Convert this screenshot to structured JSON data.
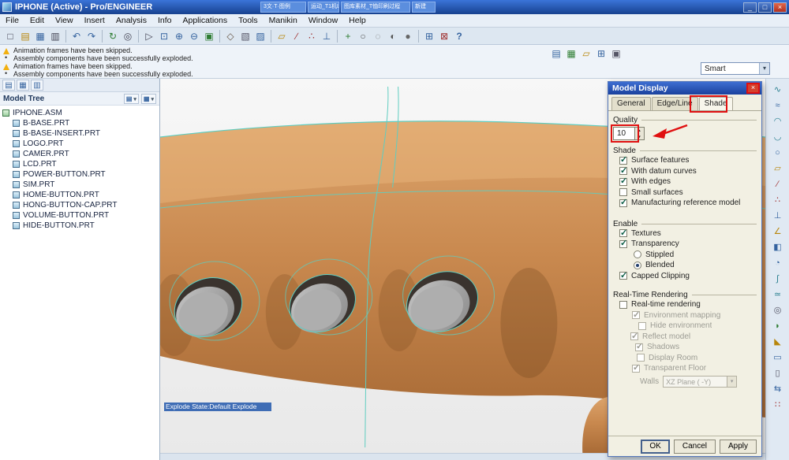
{
  "titlebar": {
    "title": "IPHONE (Active) - Pro/ENGINEER",
    "tabs": [
      "3文·T·图例",
      "运动_T1机L",
      "图库素材_T恤印刷过程",
      "新建"
    ],
    "min": "_",
    "max": "□",
    "close": "×"
  },
  "menu": [
    "File",
    "Edit",
    "View",
    "Insert",
    "Analysis",
    "Info",
    "Applications",
    "Tools",
    "Manikin",
    "Window",
    "Help"
  ],
  "toolbar_icons": [
    {
      "name": "new-file-icon",
      "glyph": "□"
    },
    {
      "name": "open-icon",
      "glyph": "▤"
    },
    {
      "name": "save-icon",
      "glyph": "▦"
    },
    {
      "name": "print-icon",
      "glyph": "▥"
    },
    {
      "name": "undo-icon",
      "glyph": "↶"
    },
    {
      "name": "redo-icon",
      "glyph": "↷"
    },
    {
      "name": "regenerate-icon",
      "glyph": "↻"
    },
    {
      "name": "search-icon",
      "glyph": "◎"
    },
    {
      "name": "select-arrow-icon",
      "glyph": "▷"
    },
    {
      "name": "refit-icon",
      "glyph": "⊡"
    },
    {
      "name": "zoom-in-icon",
      "glyph": "⊕"
    },
    {
      "name": "zoom-out-icon",
      "glyph": "⊖"
    },
    {
      "name": "repaint-icon",
      "glyph": "▣"
    },
    {
      "name": "orientation-icon",
      "glyph": "◇"
    },
    {
      "name": "layers-icon",
      "glyph": "▧"
    },
    {
      "name": "view-manager-icon",
      "glyph": "▨"
    },
    {
      "name": "datum-plane-toggle-icon",
      "glyph": "▱"
    },
    {
      "name": "datum-axis-toggle-icon",
      "glyph": "∕"
    },
    {
      "name": "datum-point-toggle-icon",
      "glyph": "∴"
    },
    {
      "name": "csys-toggle-icon",
      "glyph": "⊥"
    },
    {
      "name": "spin-center-icon",
      "glyph": "+"
    },
    {
      "name": "wireframe-icon",
      "glyph": "○"
    },
    {
      "name": "hidden-line-icon",
      "glyph": "◌"
    },
    {
      "name": "no-hidden-icon",
      "glyph": "◐"
    },
    {
      "name": "shaded-icon",
      "glyph": "●"
    },
    {
      "name": "window-icon",
      "glyph": "⊞"
    },
    {
      "name": "close-window-icon",
      "glyph": "⊠"
    },
    {
      "name": "context-help-icon",
      "glyph": "?"
    }
  ],
  "mini_icons": [
    {
      "name": "saved-views-icon",
      "glyph": "▤"
    },
    {
      "name": "model-display-icon",
      "glyph": "▦"
    },
    {
      "name": "datum-display-icon",
      "glyph": "▱"
    },
    {
      "name": "windows-icon",
      "glyph": "⊞"
    },
    {
      "name": "redraw-icon",
      "glyph": "▣"
    }
  ],
  "messages": [
    {
      "warn": true,
      "text": "Animation frames have been skipped."
    },
    {
      "warn": false,
      "text": "Assembly components have been successfully exploded."
    },
    {
      "warn": true,
      "text": "Animation frames have been skipped."
    },
    {
      "warn": false,
      "text": "Assembly components have been successfully exploded."
    }
  ],
  "selection_filter": {
    "value": "Smart"
  },
  "model_tree": {
    "title": "Model Tree",
    "root": "IPHONE.ASM",
    "items": [
      "B-BASE.PRT",
      "B-BASE-INSERT.PRT",
      "LOGO.PRT",
      "CAMER.PRT",
      "LCD.PRT",
      "POWER-BUTTON.PRT",
      "SIM.PRT",
      "HOME-BUTTON.PRT",
      "HONG-BUTTON-CAP.PRT",
      "VOLUME-BUTTON.PRT",
      "HIDE-BUTTON.PRT"
    ],
    "panel_tabs": [
      {
        "name": "model-tree-tab-icon",
        "glyph": "▤"
      },
      {
        "name": "folder-browser-tab-icon",
        "glyph": "▦"
      },
      {
        "name": "favorites-tab-icon",
        "glyph": "▥"
      }
    ]
  },
  "panel_buttons": [
    {
      "name": "show-menu-button",
      "glyph": "▤"
    },
    {
      "name": "settings-menu-button",
      "glyph": "▦"
    }
  ],
  "viewport": {
    "explode_label": "Explode State:Default Explode"
  },
  "right_icons": [
    {
      "name": "style-tool-icon",
      "glyph": "∿"
    },
    {
      "name": "spline-icon",
      "glyph": "≈"
    },
    {
      "name": "arc-up-icon",
      "glyph": "◠"
    },
    {
      "name": "arc-down-icon",
      "glyph": "◡"
    },
    {
      "name": "circle-icon",
      "glyph": "○"
    },
    {
      "name": "datum-plane-icon",
      "glyph": "▱"
    },
    {
      "name": "datum-axis-icon",
      "glyph": "∕"
    },
    {
      "name": "datum-point-icon",
      "glyph": "∴"
    },
    {
      "name": "coordinate-system-icon",
      "glyph": "⊥"
    },
    {
      "name": "sketch-tool-icon",
      "glyph": "∠"
    },
    {
      "name": "extrude-icon",
      "glyph": "◧"
    },
    {
      "name": "revolve-icon",
      "glyph": "◔"
    },
    {
      "name": "sweep-icon",
      "glyph": "∫"
    },
    {
      "name": "blend-icon",
      "glyph": "≃"
    },
    {
      "name": "hole-icon",
      "glyph": "◎"
    },
    {
      "name": "round-icon",
      "glyph": "◗"
    },
    {
      "name": "chamfer-icon",
      "glyph": "◣"
    },
    {
      "name": "shell-icon",
      "glyph": "▭"
    },
    {
      "name": "rib-icon",
      "glyph": "▯"
    },
    {
      "name": "mirror-icon",
      "glyph": "⇆"
    },
    {
      "name": "pattern-icon",
      "glyph": "∷"
    }
  ],
  "dialog": {
    "title": "Model Display",
    "close": "×",
    "tabs": [
      "General",
      "Edge/Line",
      "Shade"
    ],
    "active_tab": "Shade",
    "quality": {
      "label": "Quality",
      "value": "10",
      "up": "▲",
      "down": "▼"
    },
    "shade": {
      "label": "Shade",
      "options": [
        {
          "label": "Surface features",
          "checked": true
        },
        {
          "label": "With datum curves",
          "checked": true
        },
        {
          "label": "With edges",
          "checked": true
        },
        {
          "label": "Small surfaces",
          "checked": false
        },
        {
          "label": "Manufacturing reference model",
          "checked": true
        }
      ]
    },
    "enable": {
      "label": "Enable",
      "textures": {
        "label": "Textures",
        "checked": true
      },
      "transparency": {
        "label": "Transparency",
        "checked": true
      },
      "stippled": {
        "label": "Stippled",
        "selected": false
      },
      "blended": {
        "label": "Blended",
        "selected": true
      },
      "capped": {
        "label": "Capped Clipping",
        "checked": true
      }
    },
    "rendering": {
      "label": "Real-Time Rendering",
      "options": [
        {
          "label": "Real-time rendering",
          "checked": false,
          "disabled": false
        },
        {
          "label": "Environment mapping",
          "checked": true,
          "disabled": true
        },
        {
          "label": "Hide environment",
          "checked": false,
          "disabled": true
        },
        {
          "label": "Reflect model",
          "checked": true,
          "disabled": true
        },
        {
          "label": "Shadows",
          "checked": true,
          "disabled": true
        },
        {
          "label": "Display Room",
          "checked": false,
          "disabled": true
        },
        {
          "label": "Transparent Floor",
          "checked": true,
          "disabled": true
        }
      ],
      "walls_label": "Walls",
      "walls_value": "XZ Plane ( -Y)"
    },
    "buttons": {
      "ok": "OK",
      "cancel": "Cancel",
      "apply": "Apply"
    }
  },
  "colors": {
    "titlebar_blue": "#2a62c4",
    "annotation_red": "#e01010",
    "copper_body": "#c8854b",
    "teal_edge": "#5fcdc0",
    "explode_highlight": "#3f6db5"
  }
}
